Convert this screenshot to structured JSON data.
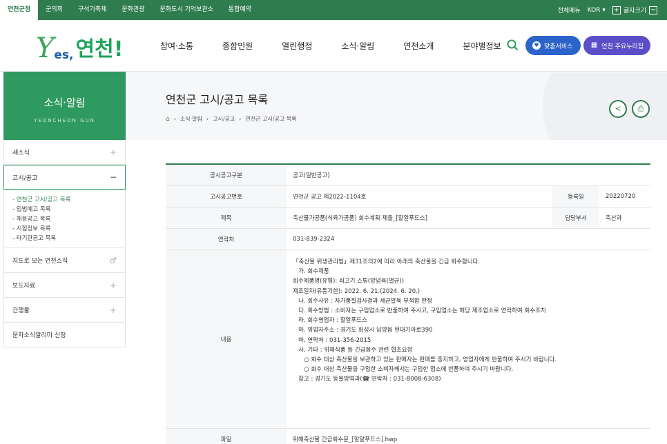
{
  "top_tabs": [
    "연천군청",
    "군의회",
    "구석기축제",
    "문화관광",
    "문화도시 기억보관소",
    "통합예약"
  ],
  "top_right": {
    "all_menu": "전체메뉴",
    "language": "KOR",
    "font_size_label": "글자크기",
    "plus": "+",
    "minus": "−"
  },
  "logo": {
    "y": "Y",
    "es": "es,",
    "name": "연천!"
  },
  "gnb": [
    "참여·소통",
    "종합민원",
    "열린행정",
    "소식·알림",
    "연천소개",
    "분야별정보"
  ],
  "pills": {
    "service": "맞춤서비스",
    "sites": "연천 주요누리집"
  },
  "page": {
    "title": "연천군 고시/공고 목록",
    "breadcrumb": [
      "소식·알림",
      "고시/공고",
      "연천군 고시/공고 목록"
    ]
  },
  "sidebar": {
    "title": "소식·알림",
    "subtitle": "YEONCHEON GUN",
    "items": [
      {
        "label": "새소식",
        "mark": "+"
      },
      {
        "label": "고시/공고",
        "mark": "−"
      },
      {
        "label": "지도로 보는 연천소식",
        "mark": "♂"
      },
      {
        "label": "보도자료",
        "mark": "+"
      },
      {
        "label": "간행물",
        "mark": "+"
      },
      {
        "label": "문자소식알리미 신청",
        "mark": ""
      }
    ],
    "subitems": [
      "연천군 고시/공고 목록",
      "입법예고 목록",
      "채용공고 목록",
      "시험정보 목록",
      "타기관공고 목록"
    ]
  },
  "table": {
    "type_label": "공시공고구분",
    "type_value": "공고(일반공고)",
    "no_label": "고시공고번호",
    "no_value": "연천군 공고 제2022-1104호",
    "date_label": "등록일",
    "date_value": "20220720",
    "title_label": "제목",
    "title_value": "축산물가공품(식육가공품) 회수계획 제출_[할알푸드스]",
    "dept_label": "담당부서",
    "dept_value": "축산과",
    "contact_label": "연락처",
    "contact_value": "031-839-2324",
    "content_label": "내용",
    "content_lines": [
      "「축산물 위생관리법」제31조의2에 따라 아래의 축산물을 긴급 회수합니다.",
      "",
      "   가. 회수제품",
      "",
      "회수제품명(유형): 쇠고기 스튜(양념육(별균))",
      "제조일자(유통기한): 2022. 6. 21.(2024. 6. 20.)",
      "",
      "   나. 회수사유 : 자가품질검사결과 세균발육 부적합 판정",
      "   다. 회수방법 : 소비자는 구입업소로 반품하여 주시고, 구입업소는 해당 제조업소로 연락하여 회수조치",
      "   라. 회수영업자 : 할알푸드스",
      "   마. 영업자주소 : 경기도 화성시 남양읍 현대기아로390",
      "   바. 연락처 : 031-356-2015",
      "   사. 기타 : 위해식품 등 긴급회수 관련 협조요청",
      "      ○ 회수 대상 축산물을 보관하고 있는 판매자는 판매를 중지하고, 영업자에게 반품하여 주시기 바랍니다.",
      "      ○ 회수 대상 축산물을 구입한 소비자께서는 구입한 업소에 반품하여 주시기 바랍니다.",
      "",
      "   참고 : 경기도 동물방역과(☎ 연락처 : 031-8008-6308)"
    ],
    "file_label": "파일",
    "file_value": "위해축산물 긴급회수문_[할알푸드스].hwp"
  }
}
